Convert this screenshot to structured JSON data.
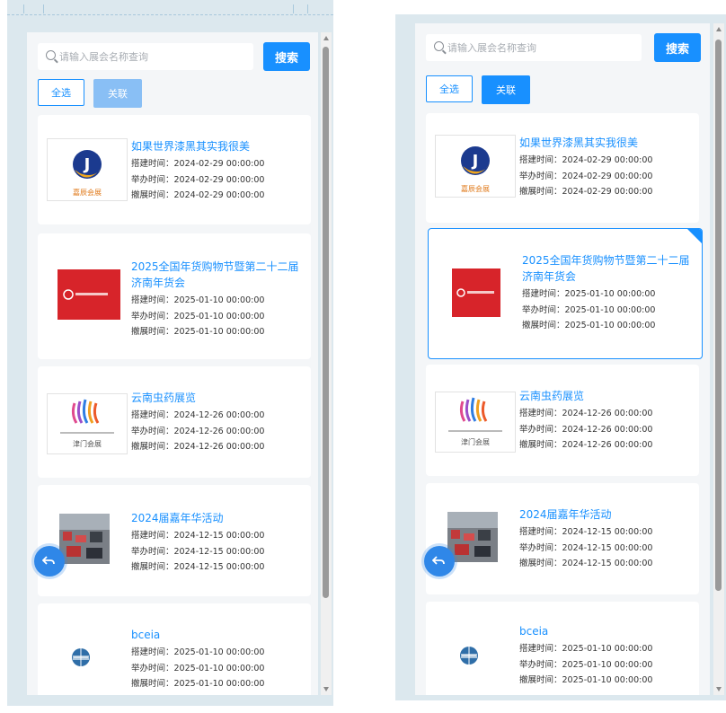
{
  "search": {
    "placeholder": "请输入展会名称查询",
    "button": "搜索"
  },
  "actions": {
    "select_all": "全选",
    "link": "关联"
  },
  "labels": {
    "build": "搭建时间：",
    "hold": "举办时间：",
    "remove": "撤展时间："
  },
  "logo_text": {
    "item1": "嘉辰会展",
    "item3": "津门会展"
  },
  "items": [
    {
      "title": "如果世界漆黑其实我很美",
      "build": "2024-02-29 00:00:00",
      "hold": "2024-02-29 00:00:00",
      "remove": "2024-02-29 00:00:00"
    },
    {
      "title": "2025全国年货购物节暨第二十二届济南年货会",
      "build": "2025-01-10 00:00:00",
      "hold": "2025-01-10 00:00:00",
      "remove": "2025-01-10 00:00:00"
    },
    {
      "title": "云南虫药展览",
      "build": "2024-12-26 00:00:00",
      "hold": "2024-12-26 00:00:00",
      "remove": "2024-12-26 00:00:00"
    },
    {
      "title": "2024届嘉年华活动",
      "build": "2024-12-15 00:00:00",
      "hold": "2024-12-15 00:00:00",
      "remove": "2024-12-15 00:00:00"
    },
    {
      "title": "bceia",
      "build": "2025-01-10 00:00:00",
      "hold": "2025-01-10 00:00:00",
      "remove": "2025-01-10 00:00:00"
    }
  ],
  "colors": {
    "accent": "#1890ff",
    "accent_disabled": "#89bff5",
    "panel_bg": "#dce8ee",
    "list_bg": "#f4f6f8"
  },
  "state": {
    "left_selected": "none",
    "right_selected": "item-2"
  }
}
